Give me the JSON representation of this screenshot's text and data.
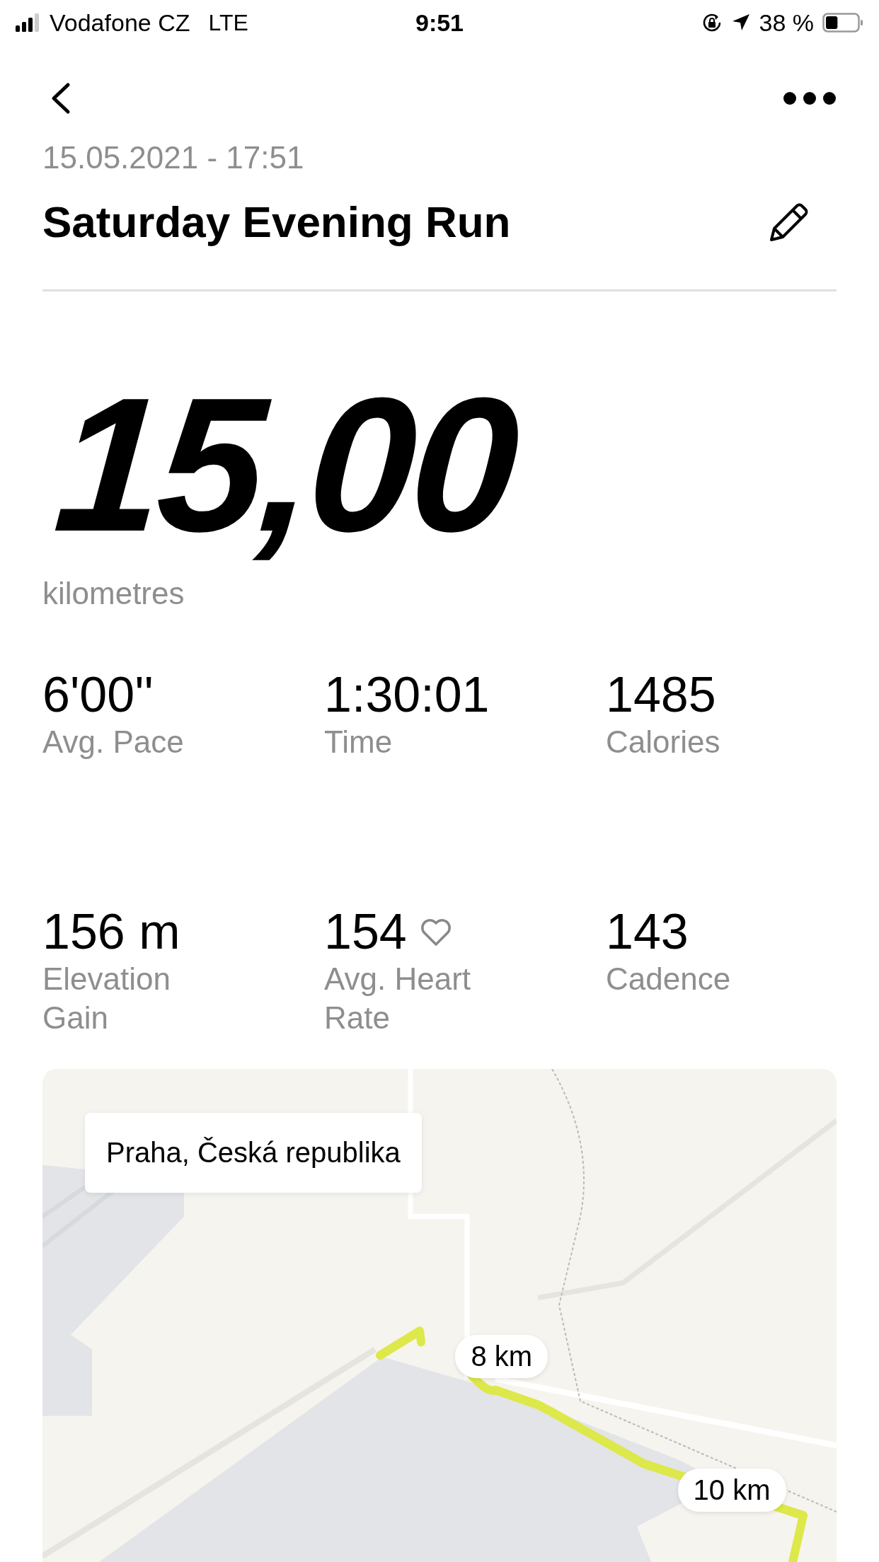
{
  "status_bar": {
    "carrier": "Vodafone CZ",
    "network": "LTE",
    "time": "9:51",
    "battery_percent": "38 %",
    "battery": {
      "level": 0.38
    }
  },
  "header": {
    "date": "15.05.2021 - 17:51",
    "title": "Saturday Evening Run"
  },
  "distance": {
    "value": "15,00",
    "unit": "kilometres"
  },
  "stats": [
    {
      "value": "6'00''",
      "label": "Avg. Pace",
      "heart": false
    },
    {
      "value": "1:30:01",
      "label": "Time",
      "heart": false
    },
    {
      "value": "1485",
      "label": "Calories",
      "heart": false
    },
    {
      "value": "156 m",
      "label": "Elevation Gain",
      "heart": false
    },
    {
      "value": "154",
      "label": "Avg. Heart Rate",
      "heart": true
    },
    {
      "value": "143",
      "label": "Cadence",
      "heart": false
    }
  ],
  "map": {
    "location": "Praha, Česká republika",
    "markers": [
      {
        "label": "8 km"
      },
      {
        "label": "10 km"
      }
    ]
  }
}
